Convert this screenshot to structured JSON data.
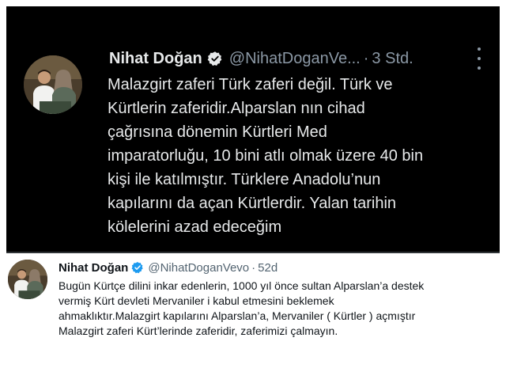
{
  "top_tweet": {
    "author_name": "Nihat Doğan",
    "handle": "@NihatDoganVe...",
    "separator": "·",
    "time": "3 Std.",
    "text_lines": [
      "Malazgirt zaferi Türk zaferi değil. Türk ve",
      "Kürtlerin zaferidir.Alparslan nın cihad",
      "çağrısına dönemin Kürtleri Med",
      "imparatorluğu, 10 bini atlı olmak üzere 40 bin",
      "kişi ile katılmıştır. Türklere Anadolu’nun",
      "kapılarını da açan Kürtlerdir. Yalan tarihin",
      "kölelerini azad edeceğim"
    ]
  },
  "bottom_tweet": {
    "author_name": "Nihat Doğan",
    "handle": "@NihatDoganVevo",
    "separator": "·",
    "time": "52d",
    "text_lines": [
      "Bugün Kürtçe dilini inkar edenlerin, 1000 yıl önce sultan Alparslan’a destek",
      "vermiş Kürt devleti Mervaniler i kabul etmesini beklemek",
      "ahmaklıktır.Malazgirt kapılarını Alparslan’a, Mervaniler ( Kürtler )  açmıştır",
      "Malazgirt zaferi Kürt’lerinde zaferidir, zaferimizi çalmayın."
    ]
  },
  "icons": {
    "verified": "verified-badge-icon",
    "more": "more-options-icon"
  },
  "colors": {
    "verified_blue": "#1d9bf0",
    "dark_bg": "#000000",
    "dark_text": "#e7e9ea",
    "dark_muted": "#8b98a5",
    "light_text": "#0f1419",
    "light_muted": "#536471"
  }
}
